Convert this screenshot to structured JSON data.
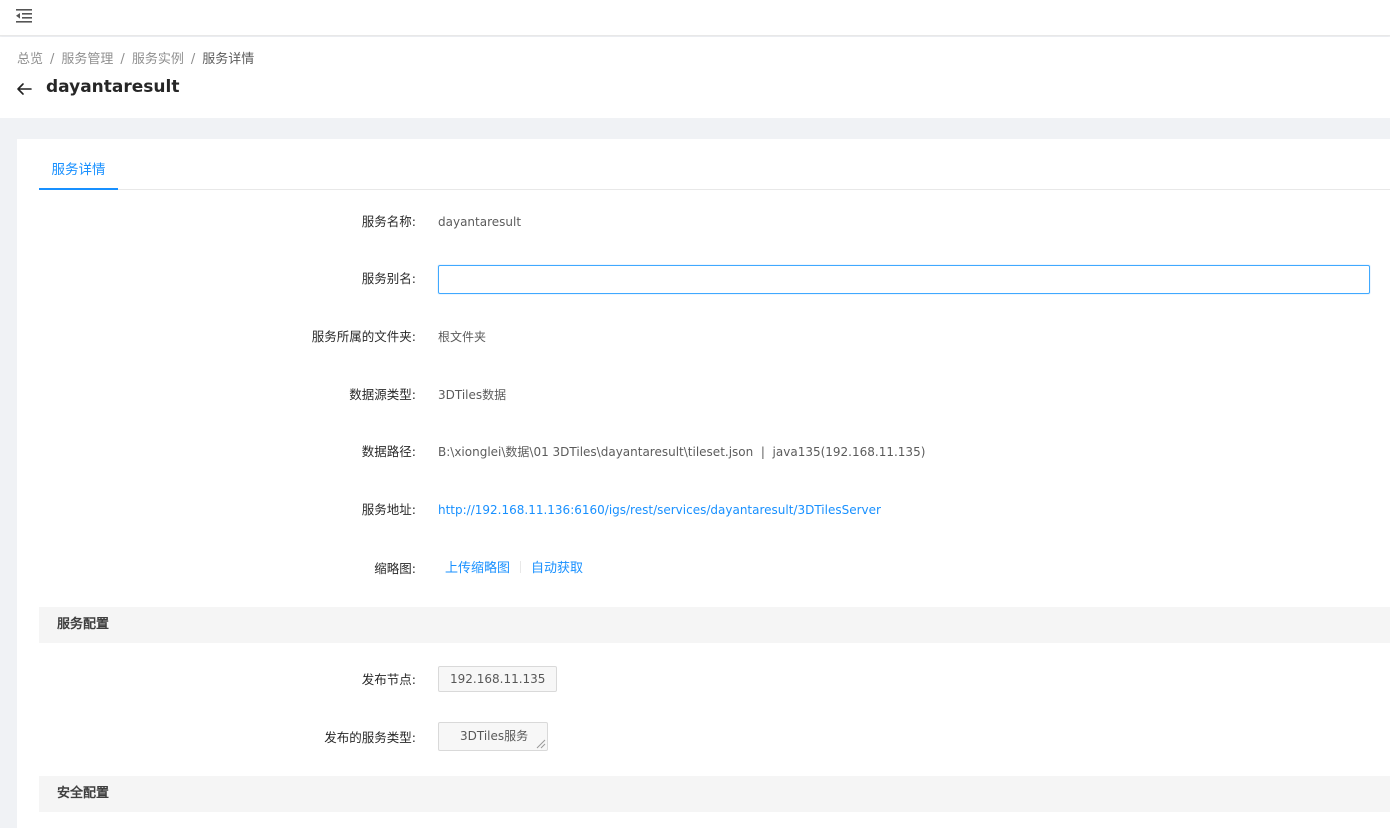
{
  "breadcrumb": {
    "items": [
      "总览",
      "服务管理",
      "服务实例",
      "服务详情"
    ],
    "separator": "/"
  },
  "header": {
    "title": "dayantaresult"
  },
  "tabs": [
    {
      "label": "服务详情",
      "active": true
    }
  ],
  "details": {
    "service_name": {
      "label": "服务名称:",
      "value": "dayantaresult"
    },
    "service_alias": {
      "label": "服务别名:",
      "value": "",
      "placeholder": ""
    },
    "folder": {
      "label": "服务所属的文件夹:",
      "value": "根文件夹"
    },
    "datasource_type": {
      "label": "数据源类型:",
      "value": "3DTiles数据"
    },
    "data_path": {
      "label": "数据路径:",
      "value": "B:\\xionglei\\数据\\01 3DTiles\\dayantaresult\\tileset.json  |  java135(192.168.11.135)"
    },
    "service_url": {
      "label": "服务地址:",
      "value": "http://192.168.11.136:6160/igs/rest/services/dayantaresult/3DTilesServer"
    },
    "thumbnail": {
      "label": "缩略图:",
      "upload": "上传缩略图",
      "auto": "自动获取"
    }
  },
  "service_config": {
    "title": "服务配置",
    "node": {
      "label": "发布节点:",
      "value": "192.168.11.135"
    },
    "service_type": {
      "label": "发布的服务类型:",
      "value": "3DTiles服务"
    }
  },
  "security_config": {
    "title": "安全配置"
  },
  "colors": {
    "primary": "#1890ff",
    "page_bg": "#f0f2f5",
    "section_bg": "#f5f5f5"
  },
  "icons": {
    "menu": "menu-fold-icon",
    "back": "arrow-left-icon",
    "resize": "resize-handle-icon"
  }
}
